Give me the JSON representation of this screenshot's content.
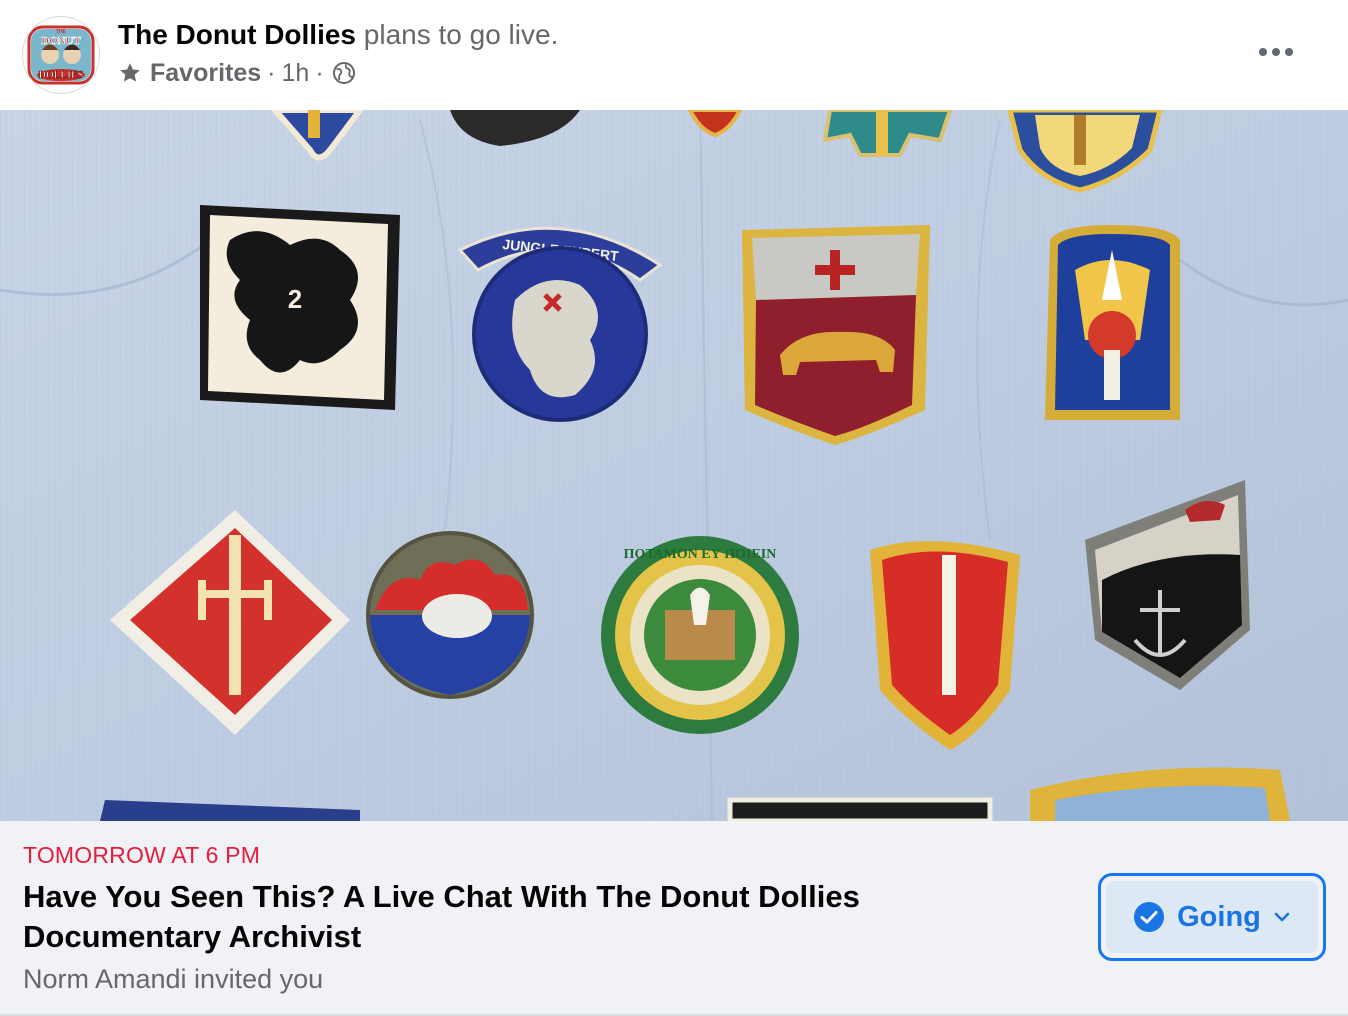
{
  "post": {
    "page_name": "The Donut Dollies",
    "action_text": "plans to go live.",
    "audience_label": "Favorites",
    "time": "1h",
    "separator": "·",
    "avatar_logo_text": {
      "top": "THE",
      "middle": "DONUT",
      "bottom": "DOLLIES"
    },
    "icons": {
      "audience": "star-icon",
      "privacy": "globe-icon",
      "more": "more-options-icon"
    }
  },
  "photo": {
    "patch_text": {
      "jungle": "JUNGLE EXPERT",
      "castle_ring": "ΠΟΤΑΜΟΝ ΕΥ ΠΟΙΕΙΝ",
      "lion_number": "2"
    }
  },
  "event": {
    "when": "TOMORROW AT 6 PM",
    "title": "Have You Seen This? A Live Chat With The Donut Dollies Documentary Archivist",
    "invite": "Norm Amandi invited you",
    "going_label": "Going",
    "going_icons": [
      "check-circle-icon",
      "chevron-down-icon"
    ]
  },
  "colors": {
    "event_when": "#e41e3f",
    "accent_blue": "#1877f2",
    "going_bg": "#dde8f5",
    "card_bg": "#f0f2f5",
    "secondary_text": "#65676b",
    "primary_text": "#050505"
  }
}
